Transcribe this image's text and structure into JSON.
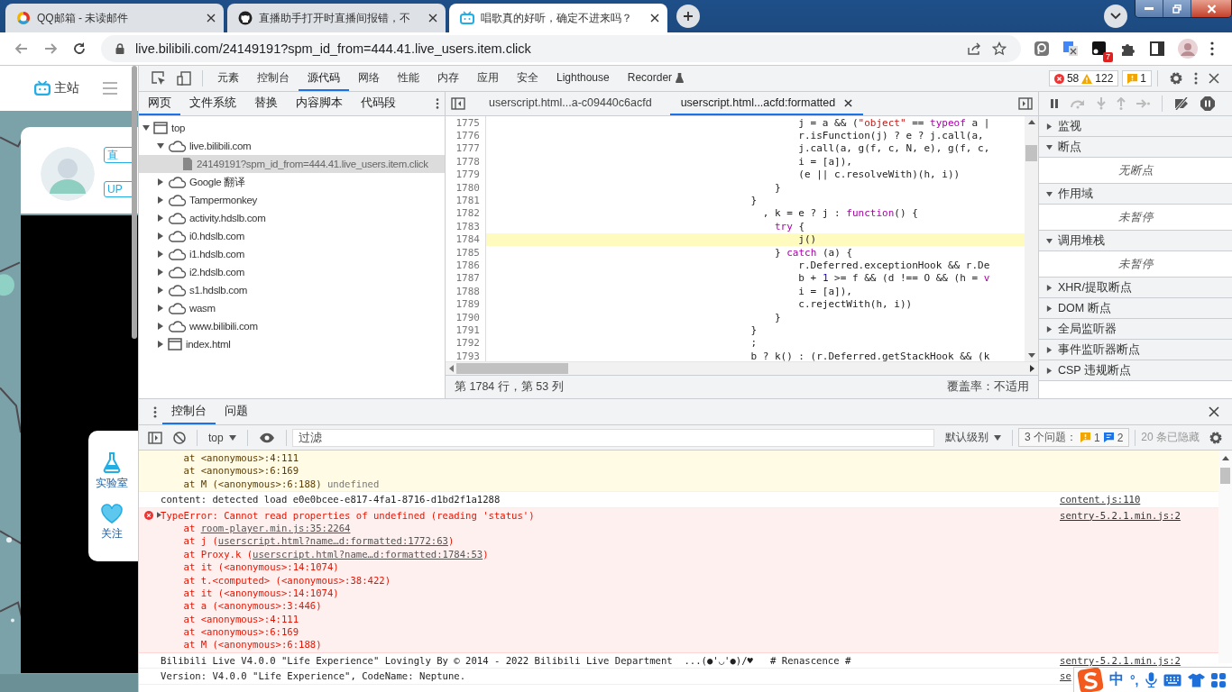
{
  "browser": {
    "tabs": [
      {
        "title": "QQ邮箱 - 未读邮件",
        "kind": "mail",
        "selected": false
      },
      {
        "title": "直播助手打开时直播间报错，不",
        "kind": "github",
        "selected": false
      },
      {
        "title": "唱歌真的好听，确定不进来吗？",
        "kind": "bili",
        "selected": true
      }
    ],
    "address": "live.bilibili.com/24149191?spm_id_from=444.41.live_users.item.click",
    "extension_badge": "7"
  },
  "page": {
    "nav_label": "主站",
    "badges": [
      "直",
      "UP"
    ],
    "side_buttons": [
      {
        "label": "实验室",
        "kind": "flask"
      },
      {
        "label": "关注",
        "kind": "heart"
      }
    ]
  },
  "devtools": {
    "tabs": [
      {
        "label": "元素",
        "kind": "plain",
        "selected": false
      },
      {
        "label": "控制台",
        "kind": "plain",
        "selected": false
      },
      {
        "label": "源代码",
        "kind": "plain",
        "selected": true
      },
      {
        "label": "网络",
        "kind": "plain",
        "selected": false
      },
      {
        "label": "性能",
        "kind": "plain",
        "selected": false
      },
      {
        "label": "内存",
        "kind": "plain",
        "selected": false
      },
      {
        "label": "应用",
        "kind": "plain",
        "selected": false
      },
      {
        "label": "安全",
        "kind": "plain",
        "selected": false
      },
      {
        "label": "Lighthouse",
        "kind": "plain",
        "selected": false
      },
      {
        "label": "Recorder",
        "kind": "experimental",
        "selected": false
      }
    ],
    "counts": {
      "errors": "58",
      "warnings": "122",
      "issues": "1"
    },
    "navigator": {
      "tabs": [
        {
          "label": "网页",
          "selected": true
        },
        {
          "label": "文件系统",
          "selected": false
        },
        {
          "label": "替换",
          "selected": false
        },
        {
          "label": "内容脚本",
          "selected": false
        },
        {
          "label": "代码段",
          "selected": false
        }
      ],
      "tree": [
        {
          "label": "top",
          "kind": "frame",
          "expanded": true,
          "selected": false,
          "children": [
            {
              "label": "live.bilibili.com",
              "kind": "domain",
              "expanded": true,
              "selected": false,
              "children": [
                {
                  "label": "24149191?spm_id_from=444.41.live_users.item.click",
                  "kind": "file",
                  "selected": true
                }
              ]
            },
            {
              "label": "Google 翻译",
              "kind": "domain",
              "expanded": false,
              "selected": false
            },
            {
              "label": "Tampermonkey",
              "kind": "domain",
              "expanded": false,
              "selected": false
            },
            {
              "label": "activity.hdslb.com",
              "kind": "domain",
              "expanded": false,
              "selected": false
            },
            {
              "label": "i0.hdslb.com",
              "kind": "domain",
              "expanded": false,
              "selected": false
            },
            {
              "label": "i1.hdslb.com",
              "kind": "domain",
              "expanded": false,
              "selected": false
            },
            {
              "label": "i2.hdslb.com",
              "kind": "domain",
              "expanded": false,
              "selected": false
            },
            {
              "label": "s1.hdslb.com",
              "kind": "domain",
              "expanded": false,
              "selected": false
            },
            {
              "label": "wasm",
              "kind": "domain",
              "expanded": false,
              "selected": false
            },
            {
              "label": "www.bilibili.com",
              "kind": "domain",
              "expanded": false,
              "selected": false
            },
            {
              "label": "index.html",
              "kind": "frame",
              "expanded": false,
              "selected": false
            }
          ]
        }
      ]
    },
    "editor": {
      "tabs": [
        {
          "label": "userscript.html...a-c09440c6acfd",
          "selected": false
        },
        {
          "label": "userscript.html...acfd:formatted",
          "selected": true
        }
      ],
      "lines": [
        {
          "number": "1775",
          "highlighted": false,
          "tokens": [
            {
              "t": "                                                    j = a && (",
              "kind": "plain"
            },
            {
              "t": "\"object\"",
              "kind": "string"
            },
            {
              "t": " == ",
              "kind": "plain"
            },
            {
              "t": "typeof",
              "kind": "keyword"
            },
            {
              "t": " a |",
              "kind": "plain"
            }
          ]
        },
        {
          "number": "1776",
          "highlighted": false,
          "tokens": [
            {
              "t": "                                                    r.isFunction(j) ? e ? j.call(a,",
              "kind": "plain"
            }
          ]
        },
        {
          "number": "1777",
          "highlighted": false,
          "tokens": [
            {
              "t": "                                                    j.call(a, g(f, c, N, e), g(f, c,",
              "kind": "plain"
            }
          ]
        },
        {
          "number": "1778",
          "highlighted": false,
          "tokens": [
            {
              "t": "                                                    i = [a]),",
              "kind": "plain"
            }
          ]
        },
        {
          "number": "1779",
          "highlighted": false,
          "tokens": [
            {
              "t": "                                                    (e || c.resolveWith)(h, i))",
              "kind": "plain"
            }
          ]
        },
        {
          "number": "1780",
          "highlighted": false,
          "tokens": [
            {
              "t": "                                                }",
              "kind": "plain"
            }
          ]
        },
        {
          "number": "1781",
          "highlighted": false,
          "tokens": [
            {
              "t": "                                            }",
              "kind": "plain"
            }
          ]
        },
        {
          "number": "1782",
          "highlighted": false,
          "tokens": [
            {
              "t": "                                              , k = e ? j : ",
              "kind": "plain"
            },
            {
              "t": "function",
              "kind": "keyword"
            },
            {
              "t": "() {",
              "kind": "plain"
            }
          ]
        },
        {
          "number": "1783",
          "highlighted": false,
          "tokens": [
            {
              "t": "                                                try",
              "kind": "keyword"
            },
            {
              "t": " {",
              "kind": "plain"
            }
          ]
        },
        {
          "number": "1784",
          "highlighted": true,
          "tokens": [
            {
              "t": "                                                    j()",
              "kind": "plain"
            }
          ]
        },
        {
          "number": "1785",
          "highlighted": false,
          "tokens": [
            {
              "t": "                                                } ",
              "kind": "plain"
            },
            {
              "t": "catch",
              "kind": "keyword"
            },
            {
              "t": " (a) {",
              "kind": "plain"
            }
          ]
        },
        {
          "number": "1786",
          "highlighted": false,
          "tokens": [
            {
              "t": "                                                    r.Deferred.exceptionHook && r.De",
              "kind": "plain"
            }
          ]
        },
        {
          "number": "1787",
          "highlighted": false,
          "tokens": [
            {
              "t": "                                                    b + ",
              "kind": "plain"
            },
            {
              "t": "1",
              "kind": "number"
            },
            {
              "t": " >= f && (d !== O && (h = ",
              "kind": "plain"
            },
            {
              "t": "v",
              "kind": "keyword"
            }
          ]
        },
        {
          "number": "1788",
          "highlighted": false,
          "tokens": [
            {
              "t": "                                                    i = [a]),",
              "kind": "plain"
            }
          ]
        },
        {
          "number": "1789",
          "highlighted": false,
          "tokens": [
            {
              "t": "                                                    c.rejectWith(h, i))",
              "kind": "plain"
            }
          ]
        },
        {
          "number": "1790",
          "highlighted": false,
          "tokens": [
            {
              "t": "                                                }",
              "kind": "plain"
            }
          ]
        },
        {
          "number": "1791",
          "highlighted": false,
          "tokens": [
            {
              "t": "                                            }",
              "kind": "plain"
            }
          ]
        },
        {
          "number": "1792",
          "highlighted": false,
          "tokens": [
            {
              "t": "                                            ;",
              "kind": "plain"
            }
          ]
        },
        {
          "number": "1793",
          "highlighted": false,
          "tokens": [
            {
              "t": "                                            b ? k() : (r.Deferred.getStackHook && (k",
              "kind": "plain"
            }
          ]
        }
      ],
      "status": {
        "position": "第 1784 行，第 53 列",
        "coverage": "覆盖率：不适用"
      }
    },
    "debugger": {
      "sections": [
        {
          "title": "监视",
          "expanded": false
        },
        {
          "title": "断点",
          "expanded": true,
          "message": "无断点"
        },
        {
          "title": "作用域",
          "expanded": true,
          "message": "未暂停"
        },
        {
          "title": "调用堆栈",
          "expanded": true,
          "message": "未暂停"
        },
        {
          "title": "XHR/提取断点",
          "expanded": false
        },
        {
          "title": "DOM 断点",
          "expanded": false
        },
        {
          "title": "全局监听器",
          "expanded": false
        },
        {
          "title": "事件监听器断点",
          "expanded": false
        },
        {
          "title": "CSP 违规断点",
          "expanded": false
        }
      ]
    },
    "drawer": {
      "tabs": [
        {
          "label": "控制台",
          "selected": true
        },
        {
          "label": "问题",
          "selected": false
        }
      ],
      "toolbar": {
        "context": "top",
        "filter_placeholder": "过滤",
        "level": "默认级别",
        "issues_label": "3 个问题：",
        "issue_counts": [
          {
            "kind": "warning",
            "count": "1"
          },
          {
            "kind": "info",
            "count": "2"
          }
        ],
        "hidden": "20 条已隐藏"
      },
      "messages": [
        {
          "kind": "warning",
          "lines": [
            [
              {
                "t": "    at <anonymous>:4:111",
                "kind": "text"
              }
            ],
            [
              {
                "t": "    at <anonymous>:6:169",
                "kind": "text"
              }
            ],
            [
              {
                "t": "    at M (<anonymous>:6:188) ",
                "kind": "text"
              },
              {
                "t": "undefined",
                "kind": "dim"
              }
            ]
          ]
        },
        {
          "kind": "info",
          "lines": [
            [
              {
                "t": "content: detected load e0e0bcee-e817-4fa1-8716-d1bd2f1a1288",
                "kind": "text"
              }
            ]
          ],
          "source": "content.js:110"
        },
        {
          "kind": "error",
          "lines": [
            [
              {
                "t": "TypeError: Cannot read properties of undefined (reading 'status')",
                "kind": "text"
              }
            ],
            [
              {
                "t": "    at ",
                "kind": "text"
              },
              {
                "t": "room-player.min.js:35:2264",
                "kind": "link"
              }
            ],
            [
              {
                "t": "    at j (",
                "kind": "text"
              },
              {
                "t": "userscript.html?name…d:formatted:1772:63",
                "kind": "link"
              },
              {
                "t": ")",
                "kind": "text"
              }
            ],
            [
              {
                "t": "    at Proxy.k (",
                "kind": "text"
              },
              {
                "t": "userscript.html?name…d:formatted:1784:53",
                "kind": "link"
              },
              {
                "t": ")",
                "kind": "text"
              }
            ],
            [
              {
                "t": "    at it (<anonymous>:14:1074)",
                "kind": "text"
              }
            ],
            [
              {
                "t": "    at t.<computed> (<anonymous>:38:422)",
                "kind": "text"
              }
            ],
            [
              {
                "t": "    at it (<anonymous>:14:1074)",
                "kind": "text"
              }
            ],
            [
              {
                "t": "    at a (<anonymous>:3:446)",
                "kind": "text"
              }
            ],
            [
              {
                "t": "    at <anonymous>:4:111",
                "kind": "text"
              }
            ],
            [
              {
                "t": "    at <anonymous>:6:169",
                "kind": "text"
              }
            ],
            [
              {
                "t": "    at M (<anonymous>:6:188)",
                "kind": "text"
              }
            ]
          ],
          "source": "sentry-5.2.1.min.js:2"
        },
        {
          "kind": "info",
          "lines": [
            [
              {
                "t": "Bilibili Live V4.0.0 \"Life Experience\" Lovingly By © 2014 - 2022 Bilibili Live Department  ...(●'◡'●)/♥   # Renascence #",
                "kind": "text"
              }
            ]
          ],
          "source": "sentry-5.2.1.min.js:2"
        },
        {
          "kind": "info",
          "lines": [
            [
              {
                "t": "Version: V4.0.0 \"Life Experience\", CodeName: Neptune.",
                "kind": "text"
              }
            ]
          ],
          "source": "se"
        }
      ]
    }
  },
  "ime": {
    "mode": "中",
    "punctuation": "°,"
  }
}
